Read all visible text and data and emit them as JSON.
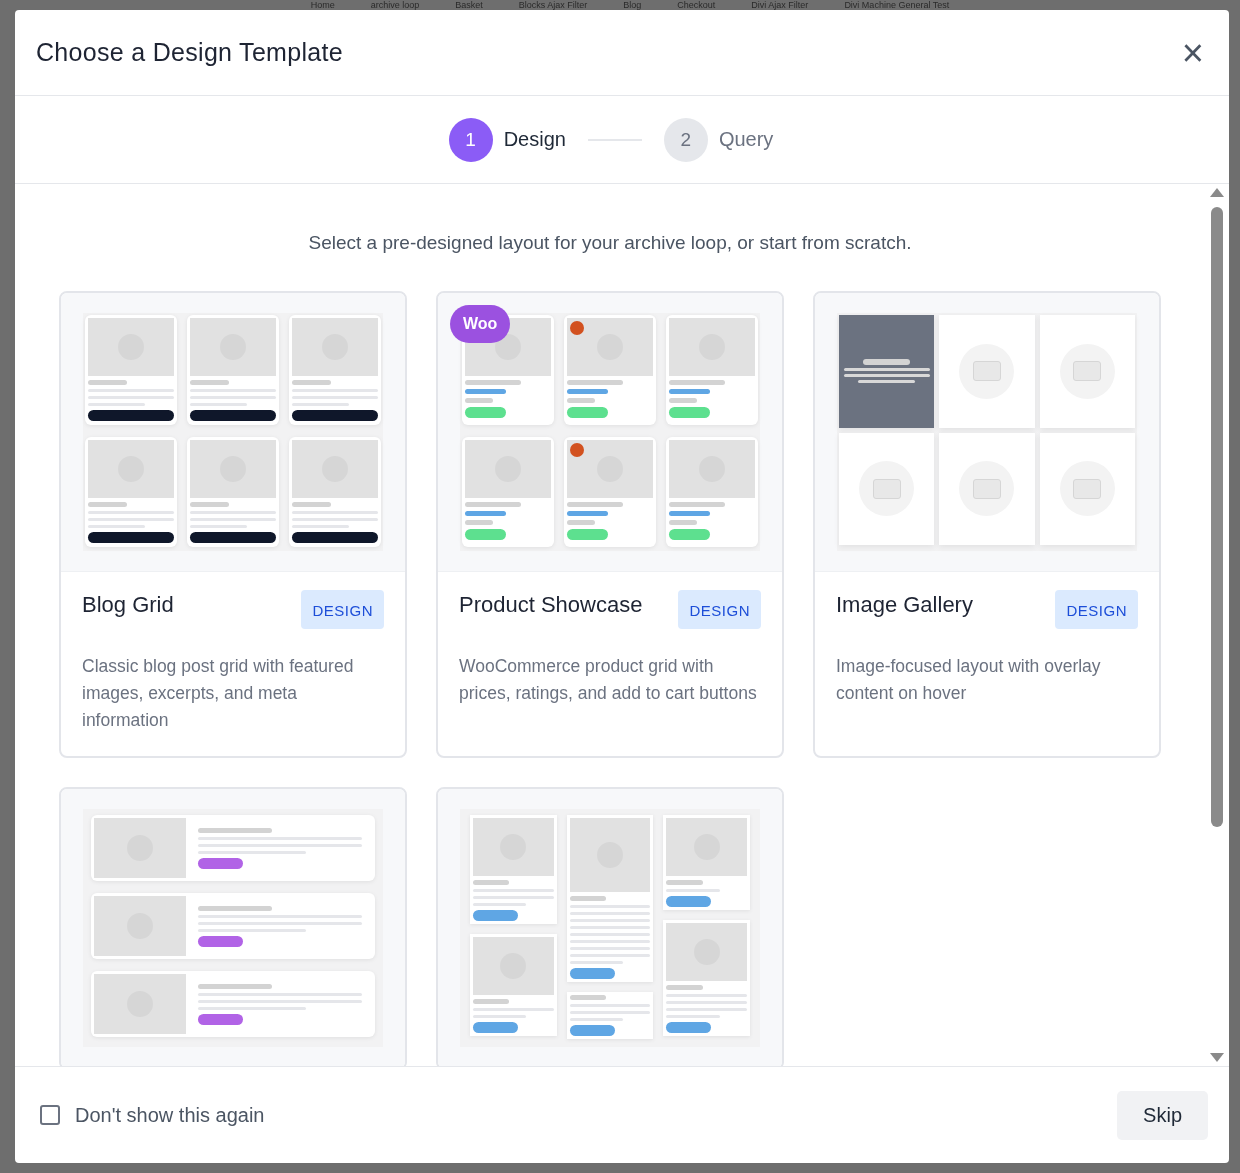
{
  "background_nav": [
    "Home",
    "archive loop",
    "Basket",
    "Blocks Ajax Filter",
    "Blog",
    "Checkout",
    "Divi Ajax Filter",
    "Divi Machine General Test"
  ],
  "dialog": {
    "title": "Choose a Design Template",
    "close": "×"
  },
  "steps": [
    {
      "number": "1",
      "label": "Design",
      "selected": true
    },
    {
      "number": "2",
      "label": "Query",
      "selected": false
    }
  ],
  "intro": "Select a pre-designed layout for your archive loop, or start from scratch.",
  "templates": [
    {
      "kind": "grid",
      "title": "Blog Grid",
      "tag": "DESIGN",
      "description": "Classic blog post grid with featured images, excerpts, and meta information"
    },
    {
      "kind": "product",
      "badge": "Woo",
      "title": "Product Showcase",
      "tag": "DESIGN",
      "description": "WooCommerce product grid with prices, ratings, and add to cart buttons"
    },
    {
      "kind": "gallery",
      "title": "Image Gallery",
      "tag": "DESIGN",
      "description": "Image-focused layout with overlay content on hover"
    },
    {
      "kind": "list"
    },
    {
      "kind": "masonry"
    }
  ],
  "footer": {
    "checkbox": {
      "label": "Don't show this again",
      "checked": false
    },
    "skip": "Skip"
  }
}
